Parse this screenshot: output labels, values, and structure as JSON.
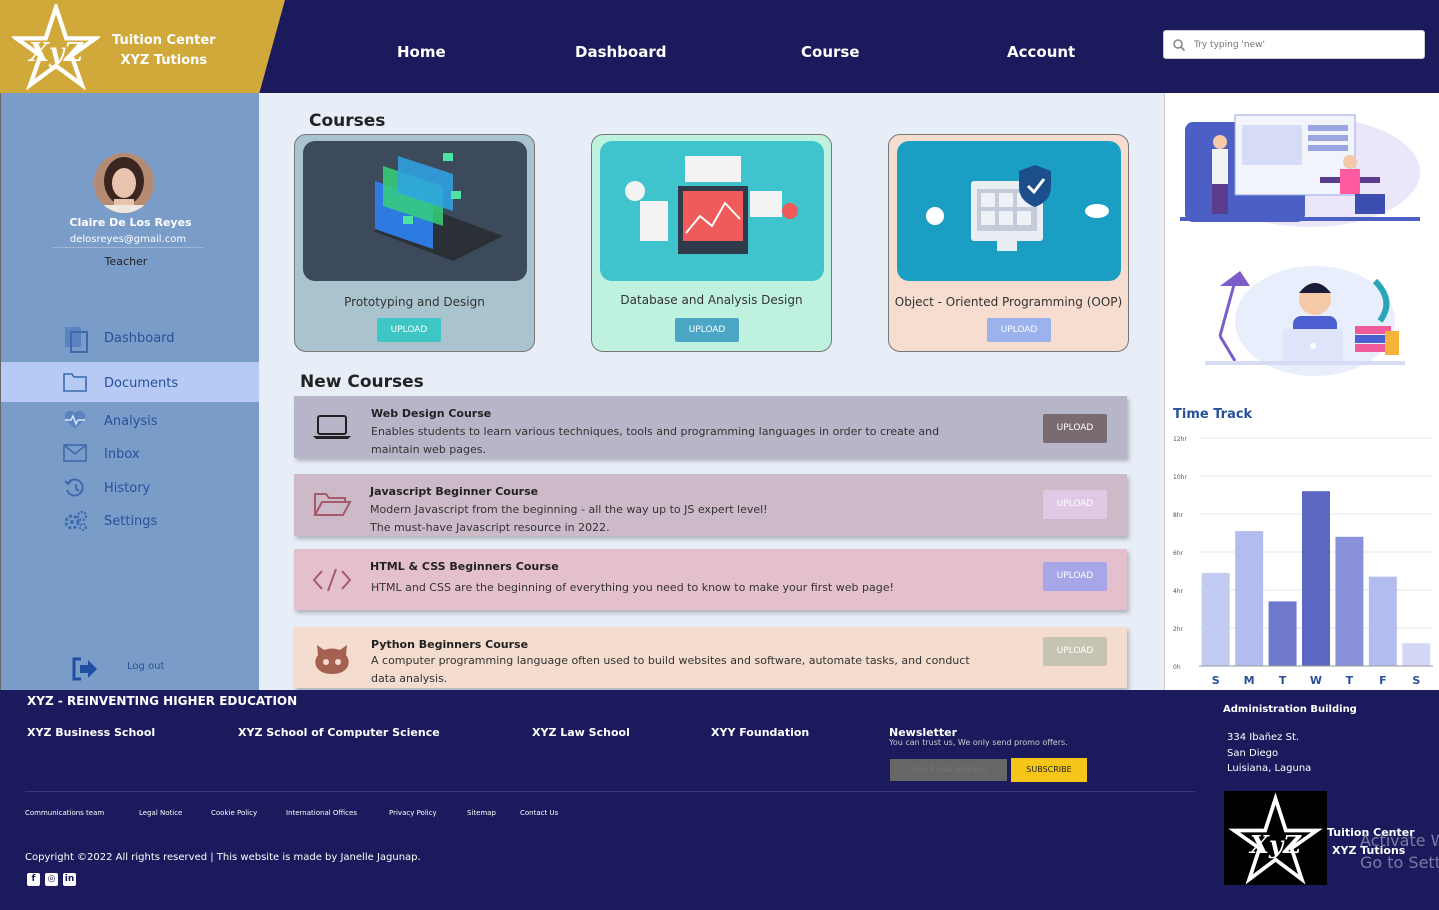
{
  "brand": {
    "line1": "Tuition Center",
    "line2": "XYZ Tutions"
  },
  "nav": [
    "Home",
    "Dashboard",
    "Course",
    "Account"
  ],
  "search": {
    "placeholder": "Try typing 'new'"
  },
  "profile": {
    "name": "Claire De Los Reyes",
    "email": "delosreyes@gmail.com",
    "role": "Teacher"
  },
  "sidebar": {
    "items": [
      {
        "label": "Dashboard",
        "icon": "document-icon"
      },
      {
        "label": "Documents",
        "icon": "folder-icon",
        "active": true
      },
      {
        "label": "Analysis",
        "icon": "heart-pulse-icon"
      },
      {
        "label": "Inbox",
        "icon": "mail-icon"
      },
      {
        "label": "History",
        "icon": "history-icon"
      },
      {
        "label": "Settings",
        "icon": "gear-icon"
      }
    ],
    "logout": "Log out"
  },
  "courses": {
    "title": "Courses",
    "cards": [
      {
        "title": "Prototyping and Design",
        "button": "UPLOAD",
        "bg": "#a9c4cf",
        "btn": "#3ec6c4"
      },
      {
        "title": "Database and Analysis Design",
        "button": "UPLOAD",
        "bg": "#bff2de",
        "btn": "#4aa6c4"
      },
      {
        "title": "Object - Oriented Programming (OOP)",
        "button": "UPLOAD",
        "bg": "#f7dcd0",
        "btn": "#9cb2ec"
      }
    ]
  },
  "new_courses": {
    "title": "New Courses",
    "rows": [
      {
        "title": "Web Design Course",
        "desc": "Enables students to learn various techniques, tools and programming languages in order to create and maintain web pages.",
        "button": "UPLOAD",
        "bg": "#b7b6c9",
        "btn": "#7a6a72",
        "icon": "laptop-icon"
      },
      {
        "title": "Javascript Beginner Course",
        "desc": "Modern Javascript from the beginning - all the way up to JS expert level!",
        "desc2": "The must-have Javascript resource in 2022.",
        "button": "UPLOAD",
        "bg": "#cdbac9",
        "btn": "#dfc9e4",
        "icon": "folder-open-icon"
      },
      {
        "title": "HTML & CSS Beginners Course",
        "desc": "HTML and CSS are the beginning of everything you need to know to make your first web page!",
        "button": "UPLOAD",
        "bg": "#e4c0cf",
        "btn": "#a6a6e9",
        "icon": "code-icon"
      },
      {
        "title": "Python Beginners Course",
        "desc": "A computer programming language often used to build websites and software, automate tasks, and conduct data analysis.",
        "button": "UPLOAD",
        "bg": "#f4dccf",
        "btn": "#c6c3b2",
        "icon": "github-icon"
      }
    ]
  },
  "time_track": {
    "title": "Time Track"
  },
  "chart_data": {
    "type": "bar",
    "title": "Time Track",
    "categories": [
      "S",
      "M",
      "T",
      "W",
      "T",
      "F",
      "S"
    ],
    "values": [
      4.9,
      7.1,
      3.4,
      9.2,
      6.8,
      4.7,
      1.2
    ],
    "ytick_labels": [
      "0h",
      "2hr",
      "4hr",
      "6hr",
      "8hr",
      "10hr",
      "12hr"
    ],
    "ylim": [
      0,
      12
    ],
    "colors": [
      "#c4cbf3",
      "#b3bcef",
      "#6e79cc",
      "#5c67c4",
      "#8891d9",
      "#b3bcef",
      "#d3d8f7"
    ]
  },
  "footer": {
    "heading": "XYZ - REINVENTING HIGHER EDUCATION",
    "schools": [
      "XYZ Business School",
      "XYZ School of Computer Science",
      "XYZ Law School",
      "XYY Foundation"
    ],
    "newsletter": {
      "title": "Newsletter",
      "subtitle": "You can trust us, We only send promo offers.",
      "placeholder": "Your Email address",
      "button": "SUBSCRIBE"
    },
    "links": [
      "Communications team",
      "Legal Notice",
      "Cookie Policy",
      "International Offices",
      "Privacy Policy",
      "Sitemap",
      "Contact Us"
    ],
    "copyright": "Copyright ©2022 All rights reserved | This website is made by Janelle Jagunap.",
    "admin": {
      "title": "Administration Building",
      "lines": [
        "334 Ibañez St.",
        "San Diego",
        "Luisiana, Laguna"
      ]
    },
    "logo_text": {
      "line1": "Tuition Center",
      "line2": "XYZ Tutions"
    },
    "watermark": {
      "line1": "Activate W",
      "line2": "Go to Settin"
    }
  }
}
